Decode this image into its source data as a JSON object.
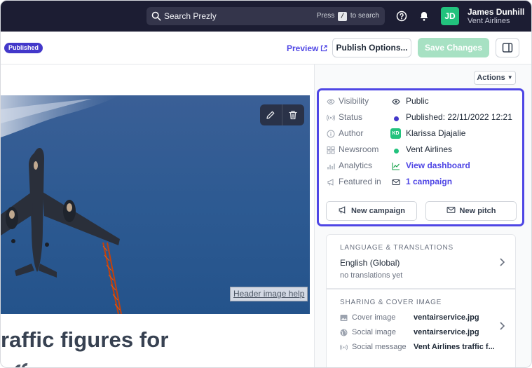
{
  "topbar": {
    "search_placeholder": "Search Prezly",
    "search_hint_prefix": "Press",
    "search_hint_key": "/",
    "search_hint_suffix": "to search",
    "user_initials": "JD",
    "user_name": "James Dunhill",
    "user_org": "Vent Airlines",
    "icons": [
      "search-icon",
      "help-icon",
      "bell-icon"
    ]
  },
  "header": {
    "status_badge": "Published",
    "preview_label": "Preview",
    "publish_options_label": "Publish Options...",
    "save_changes_label": "Save Changes",
    "colors": {
      "badge": "#4338ca",
      "save_disabled": "#a7e1c3",
      "accent": "#4f46e5"
    }
  },
  "editor": {
    "header_image_help": "Header image help",
    "headline_visible": "raffic figures for"
  },
  "sidebar": {
    "actions_label": "Actions",
    "meta": [
      {
        "label": "Visibility",
        "value": "Public"
      },
      {
        "label": "Status",
        "value": "Published: 22/11/2022 12:21"
      },
      {
        "label": "Author",
        "value": "Klarissa Djajalie",
        "initials": "KD"
      },
      {
        "label": "Newsroom",
        "value": "Vent Airlines"
      },
      {
        "label": "Analytics",
        "value": "View dashboard"
      },
      {
        "label": "Featured in",
        "value": "1 campaign"
      }
    ],
    "new_campaign_label": "New campaign",
    "new_pitch_label": "New pitch",
    "language": {
      "title": "LANGUAGE & TRANSLATIONS",
      "value": "English (Global)",
      "sub": "no translations yet"
    },
    "sharing": {
      "title": "SHARING & COVER IMAGE",
      "rows": [
        {
          "label": "Cover image",
          "value": "ventairservice.jpg"
        },
        {
          "label": "Social image",
          "value": "ventairservice.jpg"
        },
        {
          "label": "Social message",
          "value": "Vent Airlines traffic f..."
        }
      ]
    }
  }
}
